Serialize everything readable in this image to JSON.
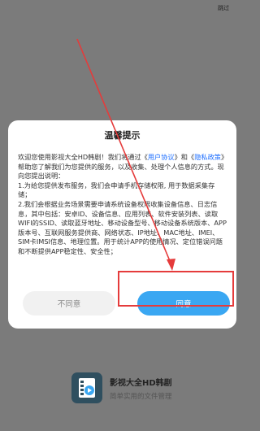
{
  "top": {
    "skip_label": "跳过"
  },
  "dialog": {
    "title": "温馨提示",
    "intro_1": "欢迎您使用影视大全HD韩剧！我们将通过《",
    "user_agreement_link": "用户协议",
    "intro_2": "》和",
    "privacy_link_open": "《",
    "privacy_link": "隐私政策",
    "intro_3": "》帮助您了解我们为您提供的服务，以及收集、处理个人信息的方式。现向您提出说明：",
    "item_1": "1.为给您提供发布服务，我们会申请手机存储权限, 用于数据采集存储；",
    "item_2": "2.我们会根据业务场景需要申请系统设备权限收集设备信息、日志信息，其中包括：安卓ID、设备信息、应用列表、软件安装列表、读取WIFI的SSID、读取蓝牙地址、移动设备型号、移动设备系统版本、APP版本号、互联网服务提供商、网络状态、IP地址、MAC地址、IMEI、SIM卡IMSI信息、地理位置。用于统计APP的使用情况、定位错误问题和不断提供APP稳定性、安全性；",
    "disagree_label": "不同意",
    "agree_label": "同意"
  },
  "brand": {
    "app_name": "影视大全HD韩剧",
    "tagline": "简单实用的文件管理"
  },
  "colors": {
    "overlay": "#7b7b7b",
    "accent": "#3aa7f2",
    "link": "#1e6fff",
    "annotation": "#e53b3b"
  }
}
